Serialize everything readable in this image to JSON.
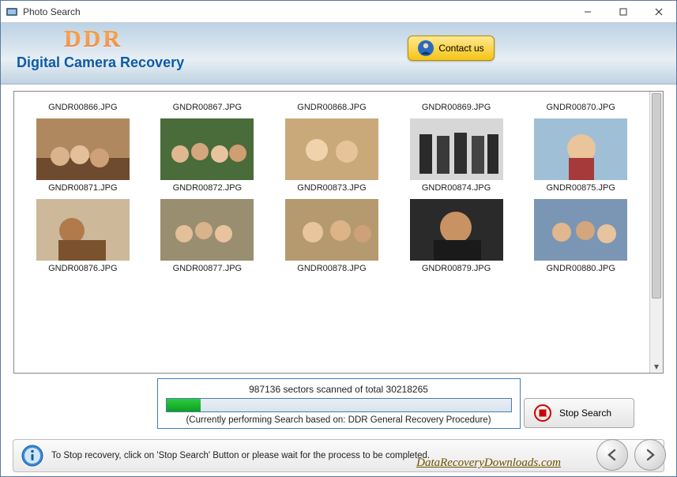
{
  "window": {
    "title": "Photo Search"
  },
  "header": {
    "logo": "DDR",
    "subtitle": "Digital Camera Recovery",
    "contact_label": "Contact us"
  },
  "thumbs": {
    "row1_labels": [
      "GNDR00866.JPG",
      "GNDR00867.JPG",
      "GNDR00868.JPG",
      "GNDR00869.JPG",
      "GNDR00870.JPG"
    ],
    "row2_labels": [
      "GNDR00871.JPG",
      "GNDR00872.JPG",
      "GNDR00873.JPG",
      "GNDR00874.JPG",
      "GNDR00875.JPG"
    ],
    "row3_labels": [
      "GNDR00876.JPG",
      "GNDR00877.JPG",
      "GNDR00878.JPG",
      "GNDR00879.JPG",
      "GNDR00880.JPG"
    ]
  },
  "progress": {
    "scanned": 987136,
    "total": 30218265,
    "status_text": "987136 sectors scanned of total 30218265",
    "sub_text": "(Currently performing Search based on:  DDR General Recovery Procedure)"
  },
  "stop_button_label": "Stop Search",
  "footer": {
    "hint": "To Stop recovery, click on 'Stop Search' Button or please wait for the process to be completed.",
    "site": "DataRecoveryDownloads.com"
  }
}
